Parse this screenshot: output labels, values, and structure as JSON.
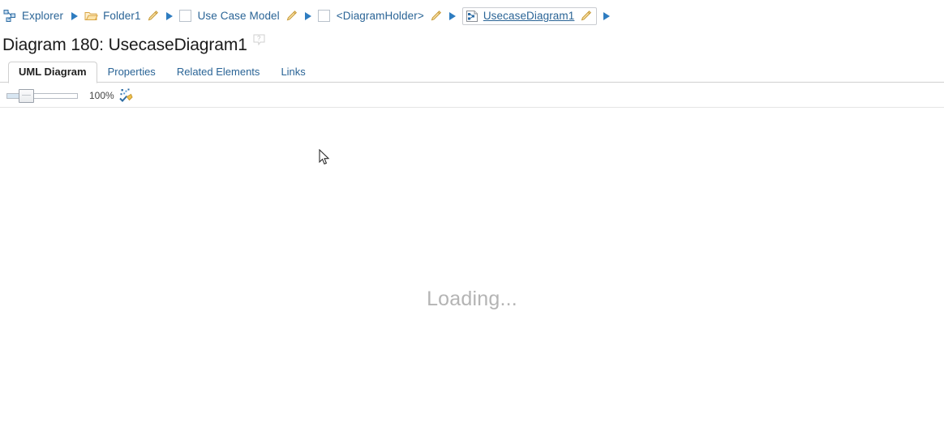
{
  "breadcrumb": {
    "items": [
      {
        "label": "Explorer",
        "icon": "explorer-network-icon",
        "has_pen": false,
        "current": false
      },
      {
        "label": "Folder1",
        "icon": "open-folder-icon",
        "has_pen": true,
        "current": false
      },
      {
        "label": "Use Case Model",
        "icon": "blank-square-icon",
        "has_pen": true,
        "current": false
      },
      {
        "label": "<DiagramHolder>",
        "icon": "blank-square-icon",
        "has_pen": true,
        "current": false
      },
      {
        "label": "UsecaseDiagram1",
        "icon": "usecase-diagram-icon",
        "has_pen": true,
        "current": true
      }
    ],
    "separator_icon": "triangle-right-icon",
    "pen_icon": "pencil-edit-icon"
  },
  "header": {
    "title": "Diagram 180: UsecaseDiagram1",
    "help_icon": "help-question-bubble-icon"
  },
  "tabs": [
    {
      "label": "UML Diagram",
      "active": true
    },
    {
      "label": "Properties",
      "active": false
    },
    {
      "label": "Related Elements",
      "active": false
    },
    {
      "label": "Links",
      "active": false
    }
  ],
  "toolbar": {
    "zoom_value": "100%",
    "zoom_slider_percent": 18,
    "fit_icon": "fit-to-window-magic-icon"
  },
  "canvas": {
    "loading_text": "Loading...",
    "cursor_icon": "mouse-pointer-arrow"
  },
  "colors": {
    "link": "#2a6496",
    "arrow": "#2e7cc0",
    "folder": "#e8b64c",
    "pen": "#d9a441",
    "loading": "#b4b4b4",
    "rule": "#d0d0d0"
  }
}
